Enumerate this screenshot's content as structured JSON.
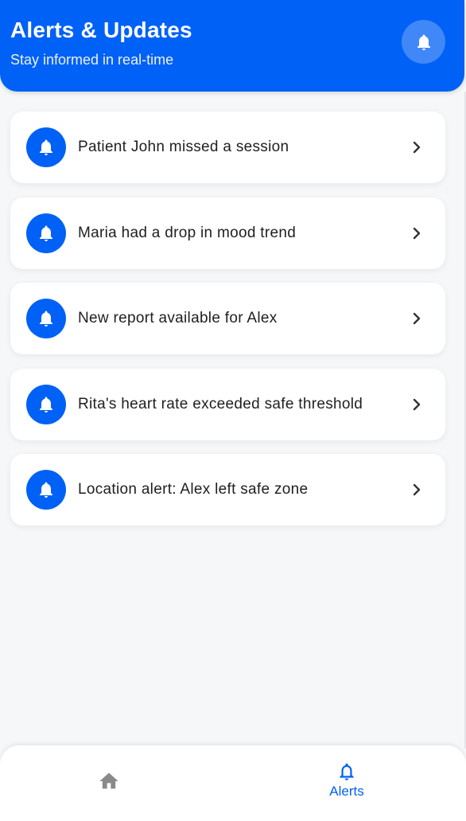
{
  "header": {
    "title": "Alerts & Updates",
    "subtitle": "Stay informed in real-time",
    "action_icon": "bell-icon"
  },
  "alerts": [
    {
      "text": "Patient John missed a session",
      "icon": "bell-icon"
    },
    {
      "text": "Maria had a drop in mood trend",
      "icon": "bell-icon"
    },
    {
      "text": "New report available for Alex",
      "icon": "bell-icon"
    },
    {
      "text": "Rita's heart rate exceeded safe threshold",
      "icon": "bell-icon"
    },
    {
      "text": "Location alert: Alex left safe zone",
      "icon": "bell-icon"
    }
  ],
  "bottom_nav": {
    "items": [
      {
        "label": "",
        "icon": "home-icon",
        "active": false
      },
      {
        "label": "Alerts",
        "icon": "bell-outline-icon",
        "active": true
      }
    ]
  },
  "colors": {
    "primary": "#0061f6",
    "background": "#f6f7f9",
    "card": "#ffffff",
    "inactive_icon": "#8a8a8a"
  }
}
